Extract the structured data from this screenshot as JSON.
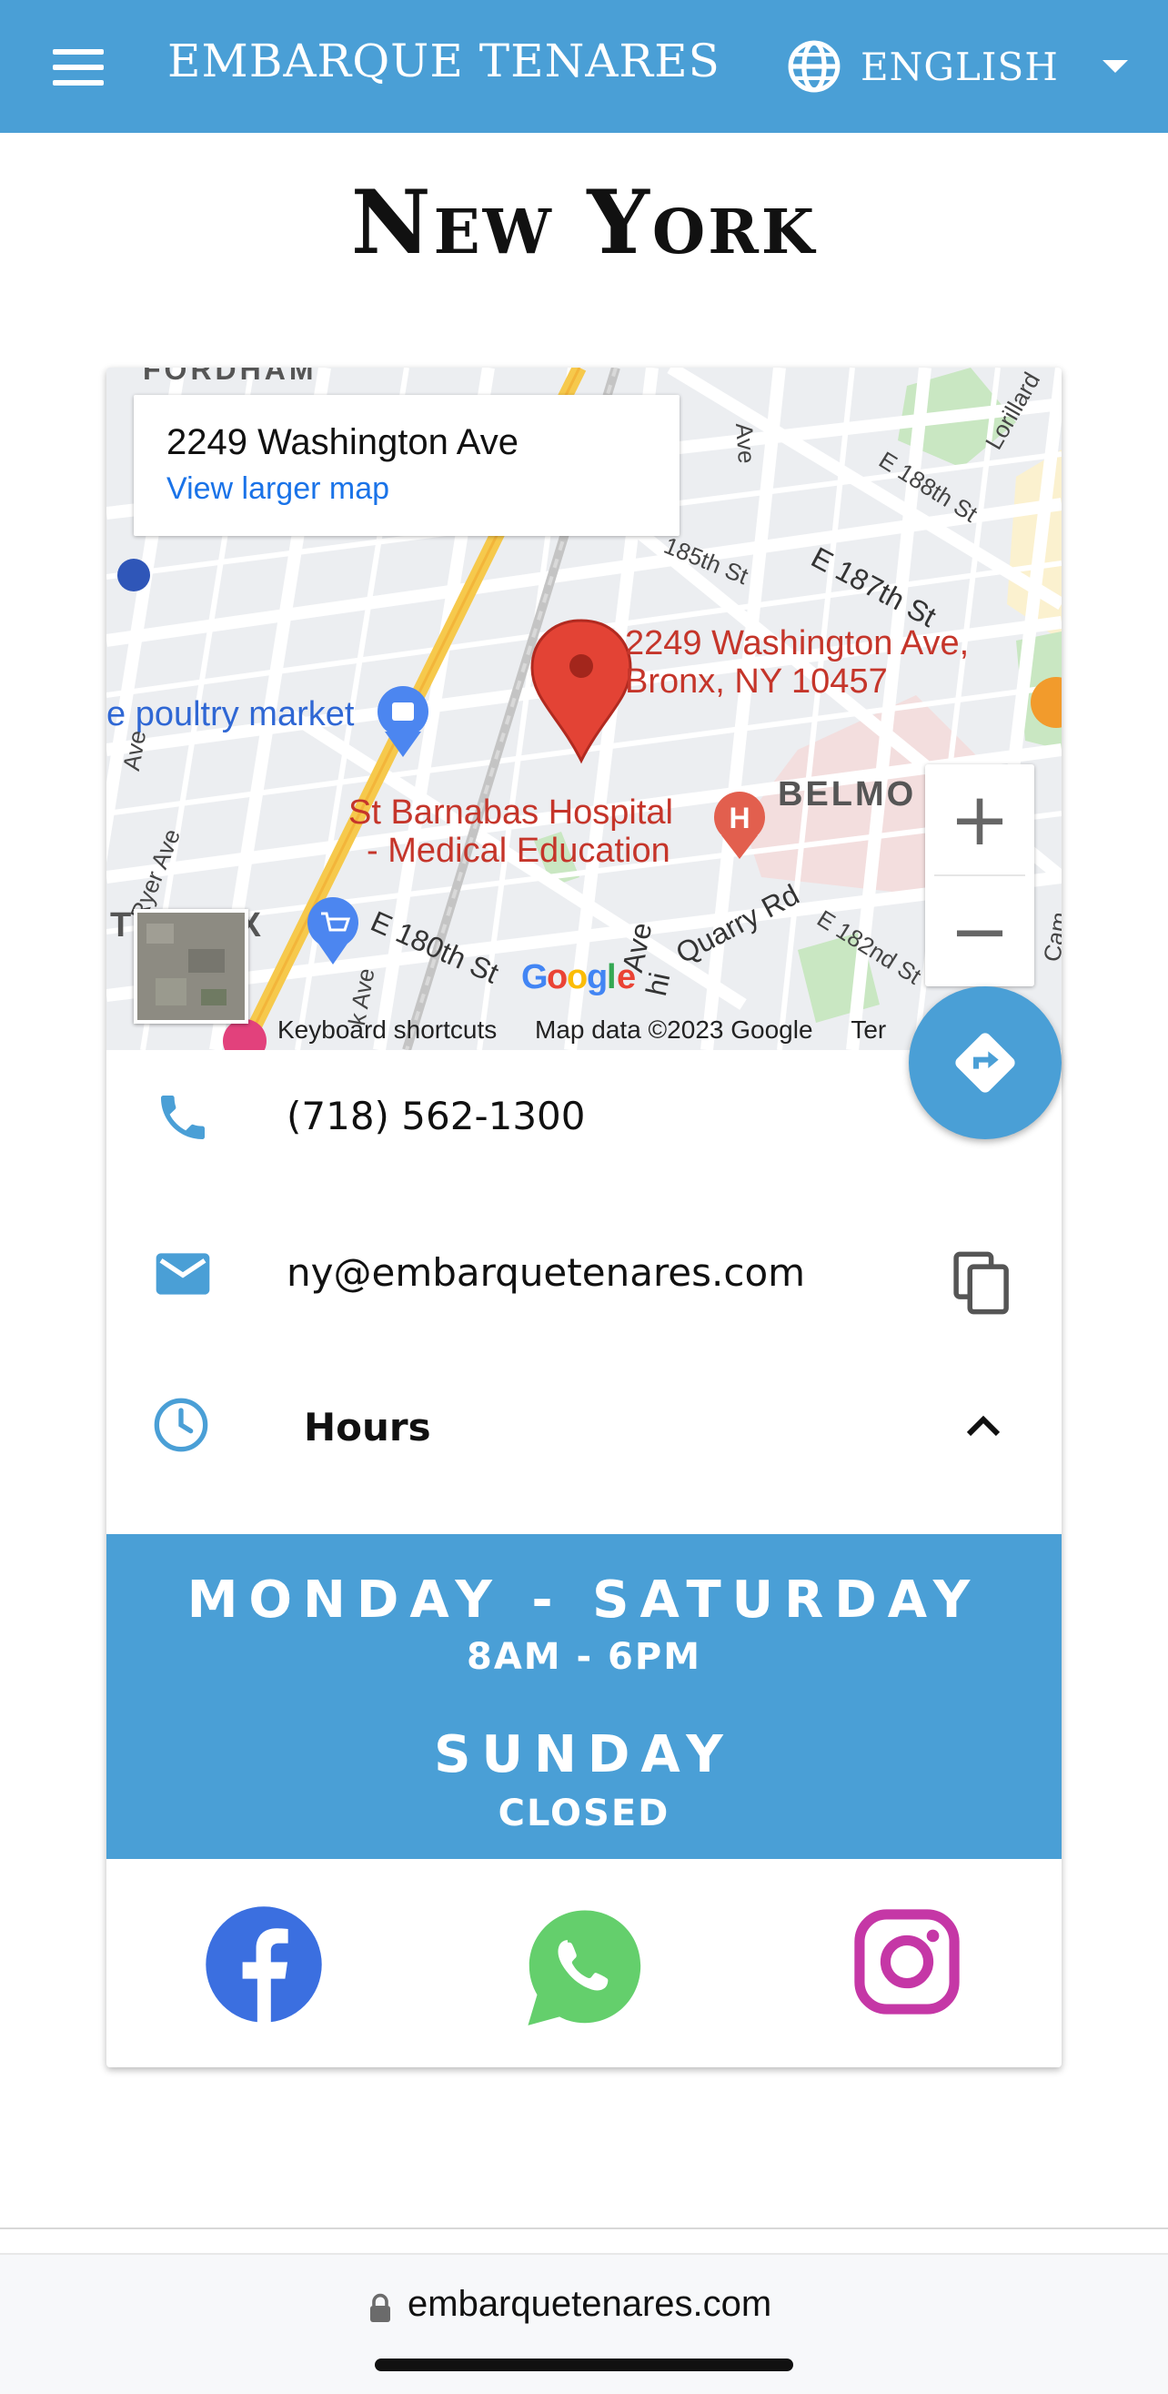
{
  "header": {
    "brand": "EMBARQUE TENARES",
    "language": "ENGLISH",
    "menu_icon": "hamburger-menu-icon",
    "language_icon": "globe-icon",
    "accent_color": "#4a9fd6"
  },
  "page": {
    "title": "New York"
  },
  "map": {
    "info_address": "2249 Washington Ave",
    "info_link": "View larger map",
    "pin_label_line1": "2249 Washington Ave,",
    "pin_label_line2": "Bronx, NY 10457",
    "poi_hospital_line1": "St Barnabas Hospital",
    "poi_hospital_line2": "- Medical Education",
    "poi_market": "e poultry market",
    "area_belmont": "BELMO",
    "area_bronx": "T",
    "area_bronx_suffix": "NX",
    "area_fordham": "FORDHAM",
    "streets": [
      "E 187th St",
      "E 188th St",
      "185th St",
      "E 180th St",
      "Quarry Rd",
      "E 182nd St",
      "Ryer Ave",
      "Ave",
      "Lorillard",
      "hi",
      "Ave",
      "Ave",
      "k Ave",
      "Cam"
    ],
    "logo": "Google",
    "footer_shortcuts": "Keyboard shortcuts",
    "footer_data": "Map data ©2023 Google",
    "footer_terms": "Ter",
    "zoom_in": "+",
    "zoom_out": "−"
  },
  "contact": {
    "phone": "(718) 562-1300",
    "email": "ny@embarquetenares.com",
    "hours_label": "Hours"
  },
  "hours": {
    "weekday_days": "MONDAY - SATURDAY",
    "weekday_time": "8AM - 6PM",
    "sunday_days": "SUNDAY",
    "sunday_time": "CLOSED"
  },
  "social": [
    "facebook-icon",
    "whatsapp-icon",
    "instagram-icon"
  ],
  "browser": {
    "url": "embarquetenares.com"
  }
}
